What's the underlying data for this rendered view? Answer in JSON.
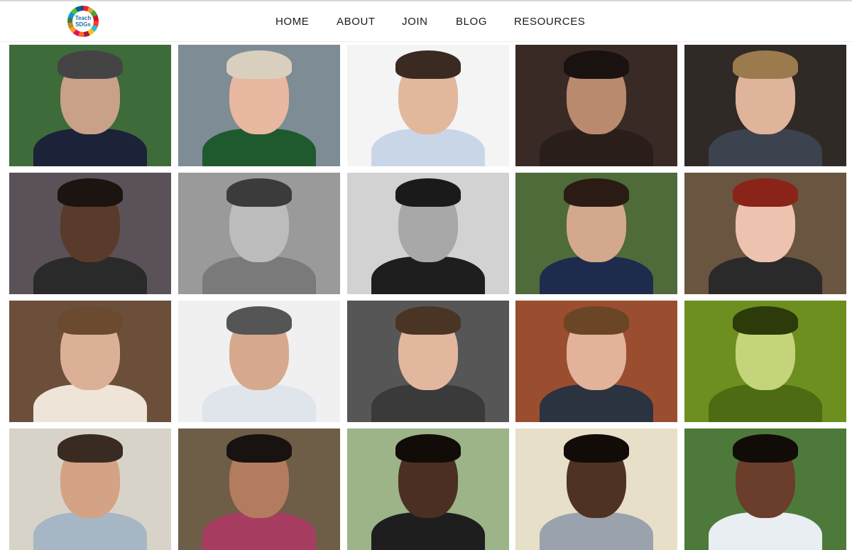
{
  "header": {
    "logo": {
      "line1": "Teach",
      "line2": "SDGs"
    },
    "nav": [
      {
        "label": "HOME"
      },
      {
        "label": "ABOUT"
      },
      {
        "label": "JOIN"
      },
      {
        "label": "BLOG"
      },
      {
        "label": "RESOURCES"
      }
    ]
  },
  "gallery": {
    "photos": [
      {
        "bg": "#3d6b3a",
        "skin": "#c9a088",
        "shirt": "#1c2238",
        "hair": "#444444"
      },
      {
        "bg": "#7d8c95",
        "skin": "#e9b8a0",
        "shirt": "#1f5a2e",
        "hair": "#d9cfbf"
      },
      {
        "bg": "#f4f4f4",
        "skin": "#e2b89d",
        "shirt": "#c9d6e8",
        "hair": "#3a2a22"
      },
      {
        "bg": "#3a2a26",
        "skin": "#b98a6e",
        "shirt": "#2a1e1b",
        "hair": "#1a1210"
      },
      {
        "bg": "#2f2a25",
        "skin": "#e0b39b",
        "shirt": "#3c434f",
        "hair": "#9b7a4d"
      },
      {
        "bg": "#5a5258",
        "skin": "#5a3a2a",
        "shirt": "#2a2a2a",
        "hair": "#1b1410"
      },
      {
        "bg": "#9a9a9a",
        "skin": "#bcbcbc",
        "shirt": "#7a7a7a",
        "hair": "#3b3b3b"
      },
      {
        "bg": "#d2d2d2",
        "skin": "#a8a8a8",
        "shirt": "#1e1e1e",
        "hair": "#1a1a1a"
      },
      {
        "bg": "#4f6b3a",
        "skin": "#d4a88c",
        "shirt": "#1f2b4d",
        "hair": "#2a1c14"
      },
      {
        "bg": "#6a5540",
        "skin": "#edc2ae",
        "shirt": "#2a2a2a",
        "hair": "#8b2418"
      },
      {
        "bg": "#6b4f3a",
        "skin": "#dcb097",
        "shirt": "#efe4d8",
        "hair": "#6b4a30"
      },
      {
        "bg": "#f0f0f0",
        "skin": "#d6a98f",
        "shirt": "#dfe5ea",
        "hair": "#555555"
      },
      {
        "bg": "#565656",
        "skin": "#e3b69e",
        "shirt": "#3a3a3a",
        "hair": "#4a3524"
      },
      {
        "bg": "#9a4e2f",
        "skin": "#e2b39a",
        "shirt": "#2b3240",
        "hair": "#6a4526"
      },
      {
        "bg": "#6c8f1f",
        "skin": "#c4d47a",
        "shirt": "#4d6b12",
        "hair": "#2d3a0a"
      },
      {
        "bg": "#d8d3c8",
        "skin": "#d4a284",
        "shirt": "#a7b6c4",
        "hair": "#3a2b22"
      },
      {
        "bg": "#6e5e48",
        "skin": "#b37c5e",
        "shirt": "#a83d62",
        "hair": "#181210"
      },
      {
        "bg": "#9db388",
        "skin": "#4a2f22",
        "shirt": "#1e1e1e",
        "hair": "#120c09"
      },
      {
        "bg": "#e8dfc8",
        "skin": "#4e3222",
        "shirt": "#9aa3ad",
        "hair": "#120c09"
      },
      {
        "bg": "#4d7a3a",
        "skin": "#6a3e2a",
        "shirt": "#e8eef2",
        "hair": "#120c09"
      }
    ]
  }
}
